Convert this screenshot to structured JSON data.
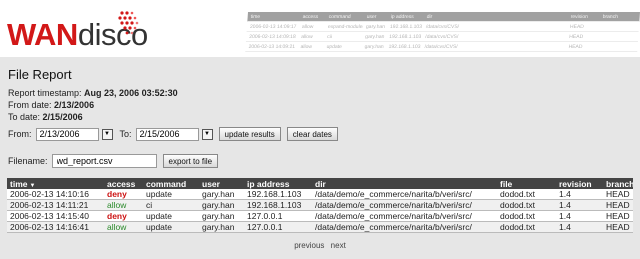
{
  "logo": {
    "part1": "WAN",
    "part2": "disco"
  },
  "ghost_table": {
    "headers": [
      "time",
      "access",
      "command",
      "user",
      "ip address",
      "dir",
      "",
      "revision",
      "branch"
    ],
    "rows": [
      [
        "2006-02-13 14:09:17",
        "allow",
        "expand-modules",
        "gary.han",
        "192.168.1.103",
        "/data/cvs/CVS/",
        "",
        "HEAD",
        ""
      ],
      [
        "2006-02-13 14:09:18",
        "allow",
        "cii",
        "gary.han",
        "192.168.1.103",
        "/data/cvs/CVS/",
        "",
        "HEAD",
        ""
      ],
      [
        "2006-02-13 14:09:21",
        "allow",
        "update",
        "gary.han",
        "192.168.1.103",
        "/data/cvs/CVS/",
        "",
        "HEAD",
        ""
      ]
    ]
  },
  "report": {
    "title": "File Report",
    "timestamp_label": "Report timestamp:",
    "timestamp_value": "Aug 23, 2006 03:52:30",
    "from_label": "From date:",
    "from_value": "2/13/2006",
    "to_label": "To date:",
    "to_value": "2/15/2006"
  },
  "filters": {
    "from_label": "From:",
    "from_value": "2/13/2006",
    "to_label": "To:",
    "to_value": "2/15/2006",
    "update_button": "update results",
    "clear_button": "clear dates"
  },
  "export": {
    "filename_label": "Filename:",
    "filename_value": "wd_report.csv",
    "export_button": "export to file"
  },
  "table": {
    "headers": {
      "time": "time",
      "access": "access",
      "command": "command",
      "user": "user",
      "ip": "ip address",
      "dir": "dir",
      "file": "file",
      "revision": "revision",
      "branch": "branch"
    },
    "rows": [
      {
        "time": "2006-02-13 14:10:16",
        "access": "deny",
        "command": "update",
        "user": "gary.han",
        "ip": "192.168.1.103",
        "dir": "/data/demo/e_commerce/narita/b/veri/src/",
        "file": "dodod.txt",
        "revision": "1.4",
        "branch": "HEAD"
      },
      {
        "time": "2006-02-13 14:11:21",
        "access": "allow",
        "command": "ci",
        "user": "gary.han",
        "ip": "192.168.1.103",
        "dir": "/data/demo/e_commerce/narita/b/veri/src/",
        "file": "dodod.txt",
        "revision": "1.4",
        "branch": "HEAD"
      },
      {
        "time": "2006-02-13 14:15:40",
        "access": "deny",
        "command": "update",
        "user": "gary.han",
        "ip": "127.0.0.1",
        "dir": "/data/demo/e_commerce/narita/b/veri/src/",
        "file": "dodod.txt",
        "revision": "1.4",
        "branch": "HEAD"
      },
      {
        "time": "2006-02-13 14:16:41",
        "access": "allow",
        "command": "update",
        "user": "gary.han",
        "ip": "127.0.0.1",
        "dir": "/data/demo/e_commerce/narita/b/veri/src/",
        "file": "dodod.txt",
        "revision": "1.4",
        "branch": "HEAD"
      }
    ]
  },
  "pager": {
    "previous": "previous",
    "next": "next"
  },
  "colors": {
    "brand_red": "#d21818",
    "deny": "#cc1111",
    "allow": "#2a8a2a",
    "header_bg": "#444444",
    "content_bg": "#e6e6e6"
  }
}
